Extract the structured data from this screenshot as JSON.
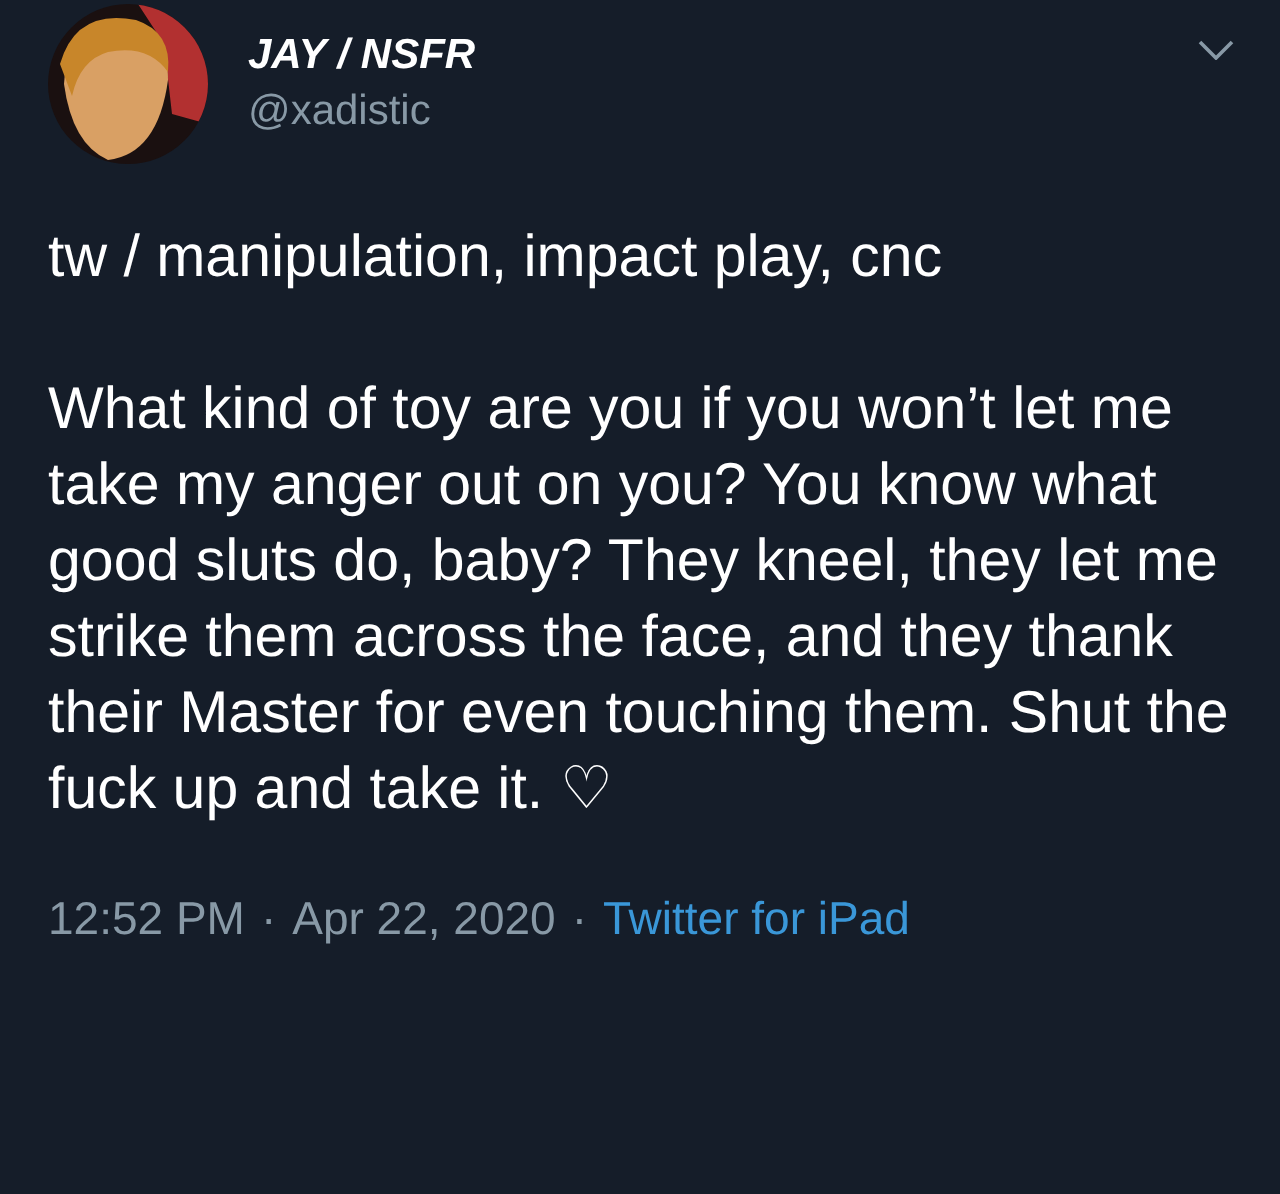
{
  "tweet": {
    "display_name": "JAY / NSFR",
    "handle": "@xadistic",
    "warning": "tw / manipulation, impact play, cnc",
    "body": "What kind of toy are you if you won’t let me take my anger out on you? You know what good sluts do, baby? They kneel, they let me strike them across the face, and they thank their Master for even touching them. Shut the fuck up and take it. ♡",
    "time": "12:52 PM",
    "separator_1": "·",
    "date": "Apr 22, 2020",
    "separator_2": "·",
    "source": "Twitter for iPad"
  }
}
